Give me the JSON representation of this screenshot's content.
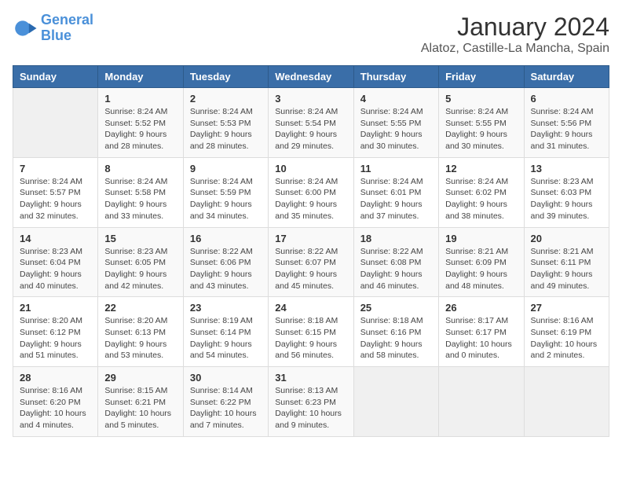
{
  "logo": {
    "line1": "General",
    "line2": "Blue"
  },
  "title": "January 2024",
  "location": "Alatoz, Castille-La Mancha, Spain",
  "days_of_week": [
    "Sunday",
    "Monday",
    "Tuesday",
    "Wednesday",
    "Thursday",
    "Friday",
    "Saturday"
  ],
  "weeks": [
    [
      {
        "day": "",
        "info": ""
      },
      {
        "day": "1",
        "info": "Sunrise: 8:24 AM\nSunset: 5:52 PM\nDaylight: 9 hours\nand 28 minutes."
      },
      {
        "day": "2",
        "info": "Sunrise: 8:24 AM\nSunset: 5:53 PM\nDaylight: 9 hours\nand 28 minutes."
      },
      {
        "day": "3",
        "info": "Sunrise: 8:24 AM\nSunset: 5:54 PM\nDaylight: 9 hours\nand 29 minutes."
      },
      {
        "day": "4",
        "info": "Sunrise: 8:24 AM\nSunset: 5:55 PM\nDaylight: 9 hours\nand 30 minutes."
      },
      {
        "day": "5",
        "info": "Sunrise: 8:24 AM\nSunset: 5:55 PM\nDaylight: 9 hours\nand 30 minutes."
      },
      {
        "day": "6",
        "info": "Sunrise: 8:24 AM\nSunset: 5:56 PM\nDaylight: 9 hours\nand 31 minutes."
      }
    ],
    [
      {
        "day": "7",
        "info": "Sunrise: 8:24 AM\nSunset: 5:57 PM\nDaylight: 9 hours\nand 32 minutes."
      },
      {
        "day": "8",
        "info": "Sunrise: 8:24 AM\nSunset: 5:58 PM\nDaylight: 9 hours\nand 33 minutes."
      },
      {
        "day": "9",
        "info": "Sunrise: 8:24 AM\nSunset: 5:59 PM\nDaylight: 9 hours\nand 34 minutes."
      },
      {
        "day": "10",
        "info": "Sunrise: 8:24 AM\nSunset: 6:00 PM\nDaylight: 9 hours\nand 35 minutes."
      },
      {
        "day": "11",
        "info": "Sunrise: 8:24 AM\nSunset: 6:01 PM\nDaylight: 9 hours\nand 37 minutes."
      },
      {
        "day": "12",
        "info": "Sunrise: 8:24 AM\nSunset: 6:02 PM\nDaylight: 9 hours\nand 38 minutes."
      },
      {
        "day": "13",
        "info": "Sunrise: 8:23 AM\nSunset: 6:03 PM\nDaylight: 9 hours\nand 39 minutes."
      }
    ],
    [
      {
        "day": "14",
        "info": "Sunrise: 8:23 AM\nSunset: 6:04 PM\nDaylight: 9 hours\nand 40 minutes."
      },
      {
        "day": "15",
        "info": "Sunrise: 8:23 AM\nSunset: 6:05 PM\nDaylight: 9 hours\nand 42 minutes."
      },
      {
        "day": "16",
        "info": "Sunrise: 8:22 AM\nSunset: 6:06 PM\nDaylight: 9 hours\nand 43 minutes."
      },
      {
        "day": "17",
        "info": "Sunrise: 8:22 AM\nSunset: 6:07 PM\nDaylight: 9 hours\nand 45 minutes."
      },
      {
        "day": "18",
        "info": "Sunrise: 8:22 AM\nSunset: 6:08 PM\nDaylight: 9 hours\nand 46 minutes."
      },
      {
        "day": "19",
        "info": "Sunrise: 8:21 AM\nSunset: 6:09 PM\nDaylight: 9 hours\nand 48 minutes."
      },
      {
        "day": "20",
        "info": "Sunrise: 8:21 AM\nSunset: 6:11 PM\nDaylight: 9 hours\nand 49 minutes."
      }
    ],
    [
      {
        "day": "21",
        "info": "Sunrise: 8:20 AM\nSunset: 6:12 PM\nDaylight: 9 hours\nand 51 minutes."
      },
      {
        "day": "22",
        "info": "Sunrise: 8:20 AM\nSunset: 6:13 PM\nDaylight: 9 hours\nand 53 minutes."
      },
      {
        "day": "23",
        "info": "Sunrise: 8:19 AM\nSunset: 6:14 PM\nDaylight: 9 hours\nand 54 minutes."
      },
      {
        "day": "24",
        "info": "Sunrise: 8:18 AM\nSunset: 6:15 PM\nDaylight: 9 hours\nand 56 minutes."
      },
      {
        "day": "25",
        "info": "Sunrise: 8:18 AM\nSunset: 6:16 PM\nDaylight: 9 hours\nand 58 minutes."
      },
      {
        "day": "26",
        "info": "Sunrise: 8:17 AM\nSunset: 6:17 PM\nDaylight: 10 hours\nand 0 minutes."
      },
      {
        "day": "27",
        "info": "Sunrise: 8:16 AM\nSunset: 6:19 PM\nDaylight: 10 hours\nand 2 minutes."
      }
    ],
    [
      {
        "day": "28",
        "info": "Sunrise: 8:16 AM\nSunset: 6:20 PM\nDaylight: 10 hours\nand 4 minutes."
      },
      {
        "day": "29",
        "info": "Sunrise: 8:15 AM\nSunset: 6:21 PM\nDaylight: 10 hours\nand 5 minutes."
      },
      {
        "day": "30",
        "info": "Sunrise: 8:14 AM\nSunset: 6:22 PM\nDaylight: 10 hours\nand 7 minutes."
      },
      {
        "day": "31",
        "info": "Sunrise: 8:13 AM\nSunset: 6:23 PM\nDaylight: 10 hours\nand 9 minutes."
      },
      {
        "day": "",
        "info": ""
      },
      {
        "day": "",
        "info": ""
      },
      {
        "day": "",
        "info": ""
      }
    ]
  ]
}
